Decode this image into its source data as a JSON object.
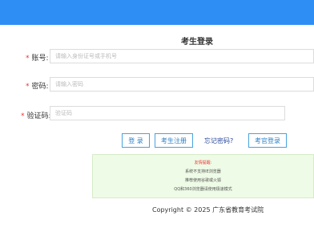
{
  "page_title": "考生登录",
  "form": {
    "account": {
      "required_mark": "*",
      "label": "账号:",
      "placeholder": "请输入身份证号或手机号"
    },
    "password": {
      "required_mark": "*",
      "label": "密码:",
      "placeholder": "请输入密码"
    },
    "captcha": {
      "required_mark": "*",
      "label": "验证码:",
      "placeholder": "验证码"
    }
  },
  "buttons": {
    "login": "登 录",
    "register": "考生注册",
    "forgot": "忘记密码?",
    "official_login": "考官登录"
  },
  "notice": {
    "heading": "友情提醒:",
    "lines": [
      "系统不支持IE浏览器",
      "推荐使用谷歌或火狐",
      "QQ和360浏览器请使用极速模式"
    ]
  },
  "footer": {
    "copyright": "Copyright © 2025 广东省教育考试院"
  },
  "colors": {
    "topbar": "#2f8ef4",
    "accent": "#2a7fc6",
    "required": "#e33333",
    "notice_bg": "#eefbe6"
  }
}
